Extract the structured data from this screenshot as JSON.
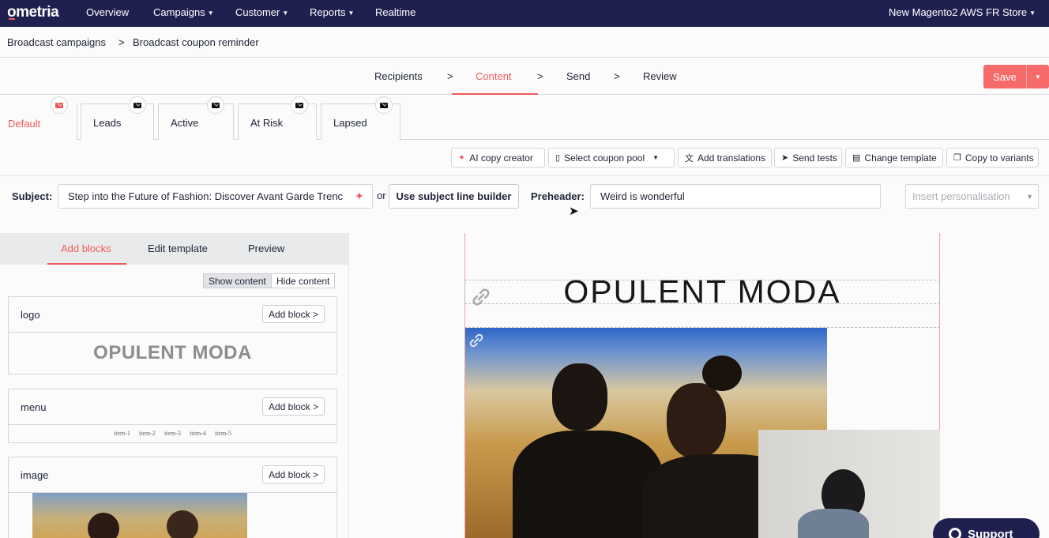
{
  "topnav": {
    "logo": "ometria",
    "items": [
      "Overview",
      "Campaigns",
      "Customer",
      "Reports",
      "Realtime"
    ],
    "store": "New Magento2 AWS FR Store"
  },
  "breadcrumb": {
    "parent": "Broadcast campaigns",
    "separator": ">",
    "current": "Broadcast coupon reminder"
  },
  "steps": {
    "items": [
      "Recipients",
      "Content",
      "Send",
      "Review"
    ],
    "active": "Content",
    "separator": ">",
    "save_label": "Save"
  },
  "variant_tabs": [
    "Default",
    "Leads",
    "Active",
    "At Risk",
    "Lapsed"
  ],
  "toolbar": {
    "ai_copy": "AI copy creator",
    "coupon_pool": "Select coupon pool",
    "translations": "Add translations",
    "send_tests": "Send tests",
    "change_template": "Change template",
    "copy_variants": "Copy to variants"
  },
  "subject_row": {
    "subject_label": "Subject:",
    "subject_value": "Step into the Future of Fashion: Discover Avant Garde Trenc",
    "or": "or",
    "builder_button": "Use subject line builder",
    "preheader_label": "Preheader:",
    "preheader_value": "Weird is wonderful",
    "personalisation_placeholder": "Insert personalisation"
  },
  "left_panel": {
    "tabs": [
      "Add blocks",
      "Edit template",
      "Preview"
    ],
    "active_tab": "Add blocks",
    "show_content": "Show content",
    "hide_content": "Hide content",
    "add_block_label": "Add block >",
    "blocks": [
      {
        "name": "logo",
        "preview": "OPULENT MODA"
      },
      {
        "name": "menu",
        "items": [
          "item-1",
          "item-2",
          "item-3",
          "item-4",
          "item-5"
        ]
      },
      {
        "name": "image"
      }
    ]
  },
  "canvas": {
    "logo_text": "OPULENT MODA"
  },
  "support": {
    "label": "Support"
  },
  "colors": {
    "nav_bg": "#1f2050",
    "accent": "#f05a5a",
    "save_bg": "#f76a6a"
  }
}
